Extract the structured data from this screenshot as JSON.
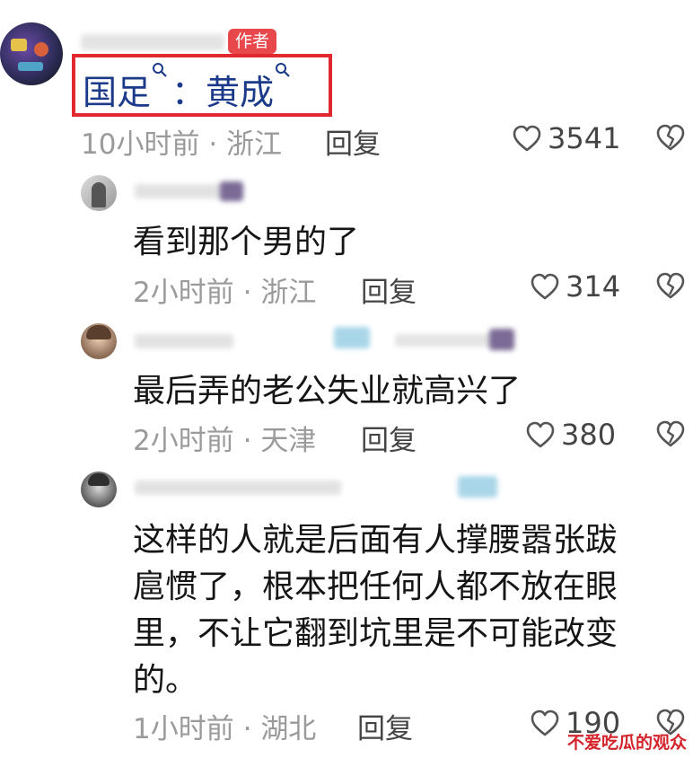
{
  "comments": [
    {
      "is_author": true,
      "author_badge": "作者",
      "text_parts": [
        "国足",
        "：黄成"
      ],
      "time": "10小时前",
      "location": "浙江",
      "reply_label": "回复",
      "likes": "3541"
    },
    {
      "text": "看到那个男的了",
      "time": "2小时前",
      "location": "浙江",
      "reply_label": "回复",
      "likes": "314"
    },
    {
      "text": "最后弄的老公失业就高兴了",
      "time": "2小时前",
      "location": "天津",
      "reply_label": "回复",
      "likes": "380"
    },
    {
      "text_lines": [
        "这样的人就是后面有人撑腰嚣张跋",
        "扈惯了，根本把任何人都不放在眼",
        "里，不让它翻到坑里是不可能改变",
        "的。"
      ],
      "time": "1小时前",
      "location": "湖北",
      "reply_label": "回复",
      "likes": "190"
    }
  ],
  "meta_separator": "·",
  "watermark": "不爱吃瓜的观众",
  "colors": {
    "highlight_border": "#e2282f",
    "badge_bg": "#e8474b",
    "link_text": "#1b3a8a",
    "meta_text": "#9a9a9a"
  },
  "icons": [
    "search-icon",
    "heart-icon",
    "broken-heart-icon"
  ]
}
